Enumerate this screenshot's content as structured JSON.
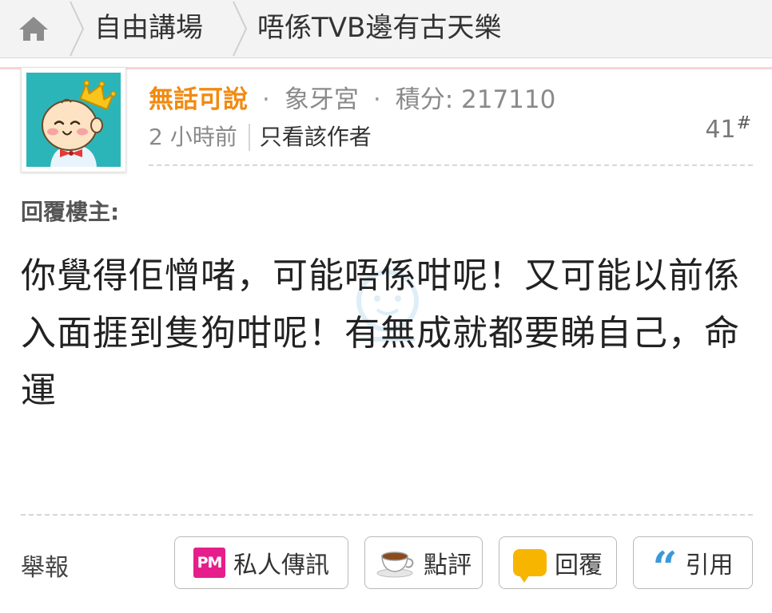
{
  "breadcrumb": {
    "home_icon": "home-icon",
    "forum": "自由講場",
    "thread": "唔係TVB邊有古天樂"
  },
  "post": {
    "avatar_icon": "baby-prince-avatar",
    "author": "無話可說",
    "separator": "·",
    "rank": "象牙宮",
    "score_label": "積分: 217110",
    "time": "2 小時前",
    "only_author": "只看該作者",
    "floor_number": "41",
    "floor_mark": "#",
    "reply_label": "回覆樓主:",
    "content": "你覺得佢憎啫，可能唔係咁呢！又可能以前係入面捱到隻狗咁呢！有無成就都要睇自己，命運"
  },
  "actions": {
    "report": "舉報",
    "pm_icon_text": "PM",
    "pm": "私人傳訊",
    "comment": "點評",
    "reply": "回覆",
    "quote": "引用"
  },
  "colors": {
    "author": "#f28a11",
    "pm_icon": "#e61e8c",
    "reply_icon": "#f7b500",
    "quote_icon": "#3a9ad9",
    "accent_line": "#f7d5d6"
  }
}
